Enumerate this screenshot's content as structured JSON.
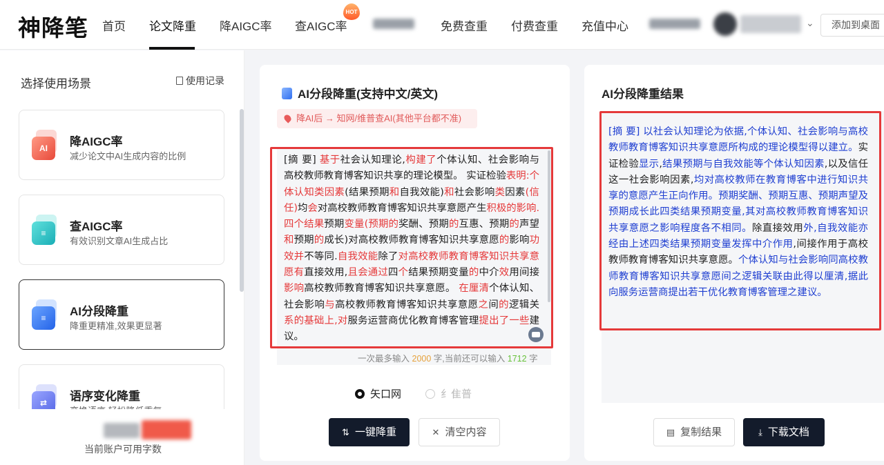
{
  "header": {
    "logo": "神降笔",
    "nav": [
      "首页",
      "论文降重",
      "降AIGC率",
      "查AIGC率",
      "免费查重",
      "付费查重",
      "充值中心"
    ],
    "active_nav": "论文降重",
    "hot_badge": "HOT",
    "add_desktop": "添加到桌面"
  },
  "sidebar": {
    "title": "选择使用场景",
    "record_link": "使用记录",
    "scenes": [
      {
        "name": "降AIGC率",
        "desc": "减少论文中AI生成内容的比例",
        "icon": "ai-reduce-icon",
        "color": "#f06b5b"
      },
      {
        "name": "查AIGC率",
        "desc": "有效识别文章AI生成占比",
        "icon": "ai-check-icon",
        "color": "#2ec4c6"
      },
      {
        "name": "AI分段降重",
        "desc": "降重更精准,效果更显著",
        "icon": "ai-segment-icon",
        "color": "#3d7cf5"
      },
      {
        "name": "语序变化降重",
        "desc": "变换语序,轻松降低重复",
        "icon": "word-order-icon",
        "color": "#6d7ff0"
      }
    ],
    "selected_scene": "AI分段降重",
    "quota_label": "当前账户可用字数"
  },
  "editor": {
    "title": "AI分段降重(支持中文/英文)",
    "notice": "降AI后 → 知网/维普查AI(其他平台都不准)",
    "input_segments": [
      {
        "t": "[摘 要] ",
        "r": false
      },
      {
        "t": "基于",
        "r": true
      },
      {
        "t": "社会认知理论,",
        "r": false
      },
      {
        "t": "构建了",
        "r": true
      },
      {
        "t": "个体认知、社会影响与高校教师教育博客知识共享的理论模型。 实证检验",
        "r": false
      },
      {
        "t": "表明:个体认知类因素",
        "r": true
      },
      {
        "t": "(结果预期",
        "r": false
      },
      {
        "t": "和",
        "r": true
      },
      {
        "t": "自我效能)",
        "r": false
      },
      {
        "t": "和",
        "r": true
      },
      {
        "t": "社会影响",
        "r": false
      },
      {
        "t": "类",
        "r": true
      },
      {
        "t": "因素",
        "r": false
      },
      {
        "t": "(信任)",
        "r": true
      },
      {
        "t": "均",
        "r": false
      },
      {
        "t": "会",
        "r": true
      },
      {
        "t": "对高校教师教育博客知识共享意愿产生",
        "r": false
      },
      {
        "t": "积极的影响.四个结果",
        "r": true
      },
      {
        "t": "预期",
        "r": false
      },
      {
        "t": "变量(预期的",
        "r": true
      },
      {
        "t": "奖酬、预期",
        "r": false
      },
      {
        "t": "的",
        "r": true
      },
      {
        "t": "互惠、预期",
        "r": false
      },
      {
        "t": "的",
        "r": true
      },
      {
        "t": "声望",
        "r": false
      },
      {
        "t": "和",
        "r": true
      },
      {
        "t": "预期",
        "r": false
      },
      {
        "t": "的",
        "r": true
      },
      {
        "t": "成长)",
        "r": false
      },
      {
        "t": "对高校教师教育博客知识共享意愿",
        "r": false
      },
      {
        "t": "的",
        "r": true
      },
      {
        "t": "影响",
        "r": false
      },
      {
        "t": "功效并",
        "r": true
      },
      {
        "t": "不等同.",
        "r": false
      },
      {
        "t": "自我效能",
        "r": true
      },
      {
        "t": "除了",
        "r": false
      },
      {
        "t": "对高校教师教育博客知识共享意愿有",
        "r": true
      },
      {
        "t": "直接效用,",
        "r": false
      },
      {
        "t": "且会通过",
        "r": true
      },
      {
        "t": "四",
        "r": false
      },
      {
        "t": "个",
        "r": true
      },
      {
        "t": "结果预期变量",
        "r": false
      },
      {
        "t": "的",
        "r": true
      },
      {
        "t": "中介",
        "r": false
      },
      {
        "t": "效",
        "r": true
      },
      {
        "t": "用间接",
        "r": false
      },
      {
        "t": "影响",
        "r": true
      },
      {
        "t": "高校教师教育博客知识共享意愿。 ",
        "r": false
      },
      {
        "t": "在厘清",
        "r": true
      },
      {
        "t": "个体认知、社会影响",
        "r": false
      },
      {
        "t": "与",
        "r": true
      },
      {
        "t": "高校教师教育博客知识共享意愿",
        "r": false
      },
      {
        "t": "之",
        "r": true
      },
      {
        "t": "间",
        "r": false
      },
      {
        "t": "的",
        "r": true
      },
      {
        "t": "逻辑关",
        "r": false
      },
      {
        "t": "系的基础上,对",
        "r": true
      },
      {
        "t": "服务运营商优化教育博客管理",
        "r": false
      },
      {
        "t": "提出了一些",
        "r": true
      },
      {
        "t": "建议。",
        "r": false
      }
    ],
    "max_prefix": "一次最多输入",
    "max_chars": "2000",
    "mid_text": "字,当前还可以输入",
    "remain_chars": "1712",
    "suffix": "字",
    "radio_options": [
      "矢口网",
      "纟隹普"
    ],
    "selected_radio": "矢口网",
    "reduce_button": "一键降重",
    "clear_button": "清空内容"
  },
  "result": {
    "title": "AI分段降重结果",
    "segments": [
      {
        "t": "[摘 要] 以社会认知理论为依据,个体认知、社会影响与高校教师教育博客知识共享意愿所构成的理论模型得以建立。",
        "b": true
      },
      {
        "t": "实证检验",
        "b": false
      },
      {
        "t": "显示",
        "b": true
      },
      {
        "t": ",",
        "b": false
      },
      {
        "t": "结果预期与自我效能等个体认知因素",
        "b": true
      },
      {
        "t": ",以及信任这一社会影响因素,",
        "b": false
      },
      {
        "t": "均对高校教师在教育博客中进行知识共享的意愿产生正向作用。预期奖酬、预期互惠、预期声望及预期成长此四类结果预期变量,其对高校教师教育博客知识共享意愿之影响程度各不相同。",
        "b": true
      },
      {
        "t": "除直接效用",
        "b": false
      },
      {
        "t": "外,自我效能亦经由上述四类结果预期变量发挥中介作用",
        "b": true
      },
      {
        "t": ",间接作用于高校教师教育博客知识共享意愿。",
        "b": false
      },
      {
        "t": "个体认知与社会影响同高校教师教育博客知识共享意愿间之逻辑关联由此得以厘清,据此向服务运营商提出若干优化教育博客管理之建议。",
        "b": true
      }
    ],
    "copy_button": "复制结果",
    "download_button": "下载文档"
  }
}
